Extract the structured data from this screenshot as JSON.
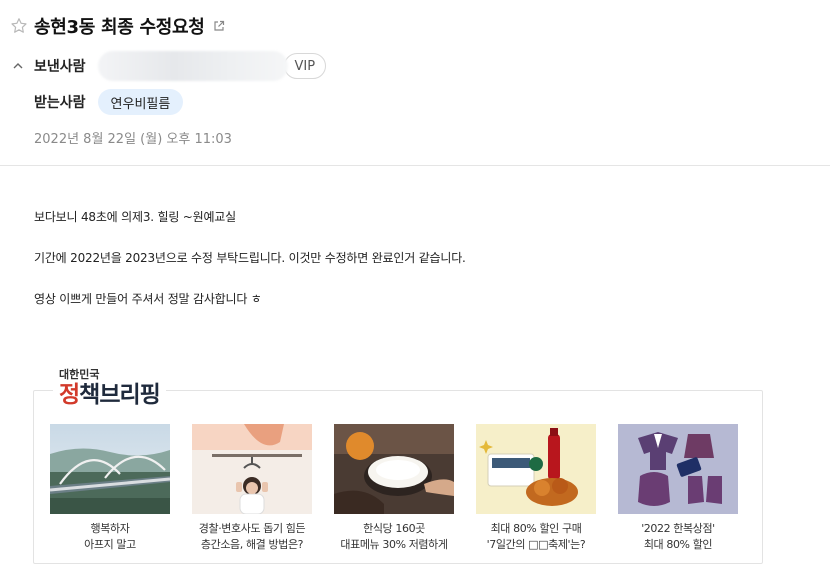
{
  "mail": {
    "subject": "송현3동 최종 수정요청",
    "sender_label": "보낸사람",
    "vip_badge": "VIP",
    "recipient_label": "받는사람",
    "recipient": "연우비필름",
    "date": "2022년 8월 22일 (월) 오후 11:03"
  },
  "body": {
    "line1": "보다보니 48초에 의제3. 힐링 ~원예교실",
    "line2": "기간에 2022년을 2023년으로 수정 부탁드립니다. 이것만 수정하면 완료인거 같습니다.",
    "line3": "영상 이쁘게 만들어 주셔서 정말 감사합니다 ㅎ"
  },
  "banner": {
    "logo_small": "대한민국",
    "logo_big_1": "정",
    "logo_big_2": "책브리핑",
    "cards": [
      {
        "line1": "행복하자",
        "line2": "아프지 말고"
      },
      {
        "line1": "경찰·변호사도 돕기 힘든",
        "line2": "층간소음, 해결 방법은?"
      },
      {
        "line1": "한식당 160곳",
        "line2": "대표메뉴 30% 저렴하게"
      },
      {
        "line1": "최대 80% 할인 구매",
        "line2": "'7일간의 □□축제'는?"
      },
      {
        "line1": "'2022 한복상점'",
        "line2": "최대 80% 할인"
      }
    ]
  },
  "colors": {
    "chip_bg": "#e4f0fd",
    "accent_red": "#d23a2b"
  }
}
